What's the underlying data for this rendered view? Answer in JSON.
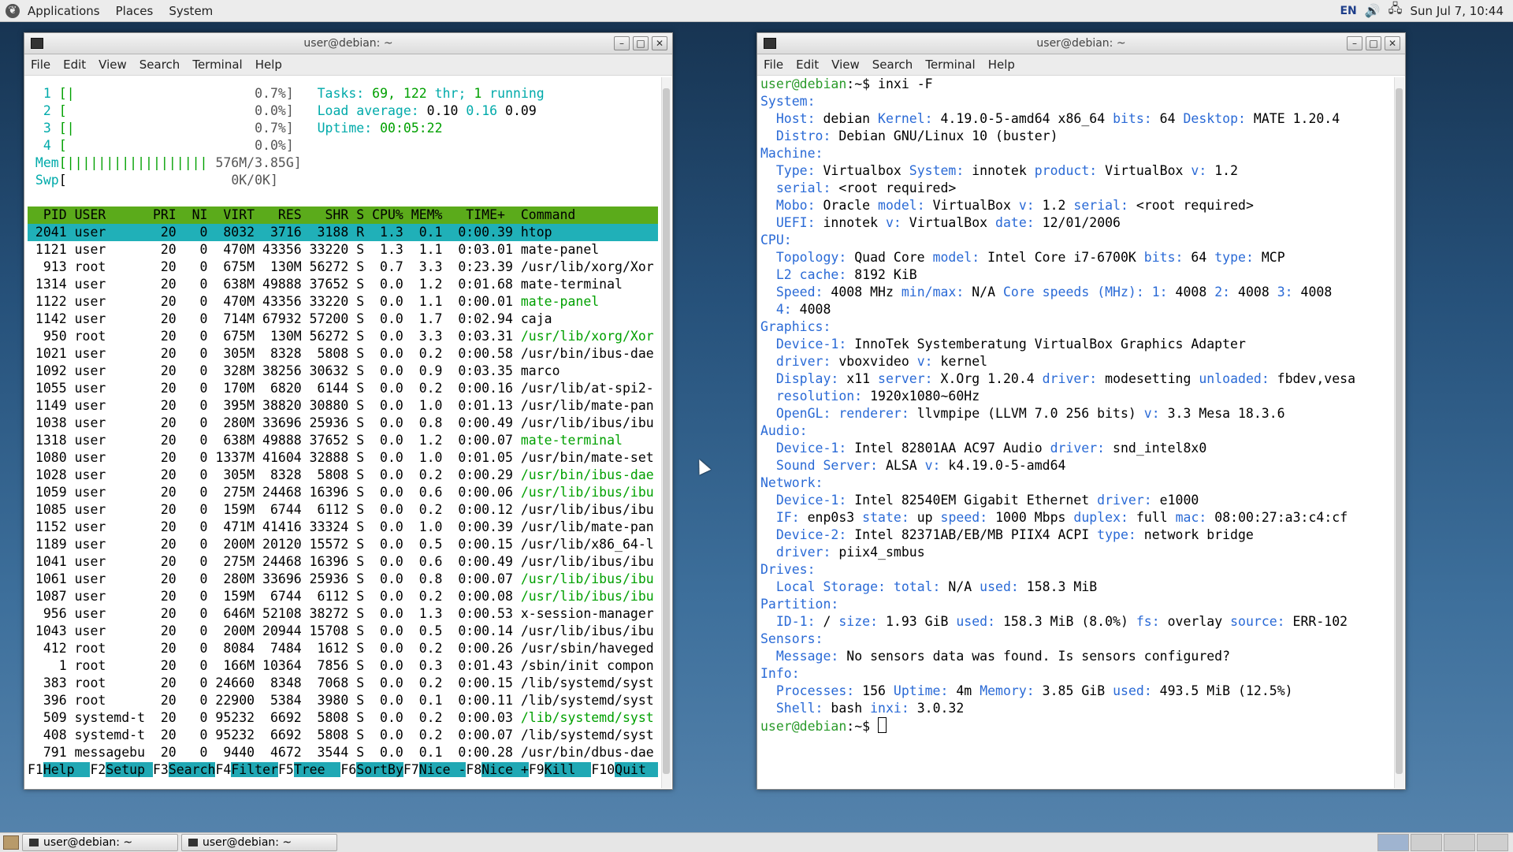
{
  "top_panel": {
    "menus": [
      "Applications",
      "Places",
      "System"
    ],
    "lang": "EN",
    "clock": "Sun Jul 7, 10:44"
  },
  "htop_window": {
    "title": "user@debian: ~",
    "menus": [
      "File",
      "Edit",
      "View",
      "Search",
      "Terminal",
      "Help"
    ],
    "cpus": [
      {
        "id": "1",
        "bar": "[|",
        "pct": "0.7%]"
      },
      {
        "id": "2",
        "bar": "[",
        "pct": "0.0%]"
      },
      {
        "id": "3",
        "bar": "[|",
        "pct": "0.7%]"
      },
      {
        "id": "4",
        "bar": "[",
        "pct": "0.0%]"
      }
    ],
    "mem": {
      "label": "Mem",
      "bar": "[||||||||||||||||||",
      "value": "576M/3.85G]"
    },
    "swp": {
      "label": "Swp",
      "bar": "[",
      "value": "0K/0K]"
    },
    "tasks": {
      "label": "Tasks:",
      "count": "69,",
      "thr": "122",
      "thr_label": "thr;",
      "running": "1",
      "running_label": "running"
    },
    "load": {
      "label": "Load average:",
      "v1": "0.10",
      "v2": "0.16",
      "v3": "0.09"
    },
    "uptime": {
      "label": "Uptime:",
      "value": "00:05:22"
    },
    "columns": "  PID USER      PRI  NI  VIRT   RES   SHR S CPU% MEM%   TIME+  Command",
    "selected_row": " 2041 user       20   0  8032  3716  3188 R  1.3  0.1  0:00.39 htop",
    "rows": [
      {
        "l": " 1121 user       20   0  470M 43356 33220 S  1.3  1.1  0:03.01 ",
        "cmd": "mate-panel",
        "t": "n"
      },
      {
        "l": "  913 root       20   0  675M  130M 56272 S  0.7  3.3  0:23.39 ",
        "cmd": "/usr/lib/xorg/Xor",
        "t": "n"
      },
      {
        "l": " 1314 user       20   0  638M 49888 37652 S  0.0  1.2  0:01.68 ",
        "cmd": "mate-terminal",
        "t": "n"
      },
      {
        "l": " 1122 user       20   0  470M 43356 33220 S  0.0  1.1  0:00.01 ",
        "cmd": "mate-panel",
        "t": "g"
      },
      {
        "l": " 1142 user       20   0  714M 67932 57200 S  0.0  1.7  0:02.94 ",
        "cmd": "caja",
        "t": "n"
      },
      {
        "l": "  950 root       20   0  675M  130M 56272 S  0.0  3.3  0:03.31 ",
        "cmd": "/usr/lib/xorg/Xor",
        "t": "g"
      },
      {
        "l": " 1021 user       20   0  305M  8328  5808 S  0.0  0.2  0:00.58 ",
        "cmd": "/usr/bin/ibus-dae",
        "t": "n"
      },
      {
        "l": " 1092 user       20   0  328M 38256 30632 S  0.0  0.9  0:03.35 ",
        "cmd": "marco",
        "t": "n"
      },
      {
        "l": " 1055 user       20   0  170M  6820  6144 S  0.0  0.2  0:00.16 ",
        "cmd": "/usr/lib/at-spi2-",
        "t": "n"
      },
      {
        "l": " 1149 user       20   0  395M 38820 30880 S  0.0  1.0  0:01.13 ",
        "cmd": "/usr/lib/mate-pan",
        "t": "n"
      },
      {
        "l": " 1038 user       20   0  280M 33696 25936 S  0.0  0.8  0:00.49 ",
        "cmd": "/usr/lib/ibus/ibu",
        "t": "n"
      },
      {
        "l": " 1318 user       20   0  638M 49888 37652 S  0.0  1.2  0:00.07 ",
        "cmd": "mate-terminal",
        "t": "g"
      },
      {
        "l": " 1080 user       20   0 1337M 41604 32888 S  0.0  1.0  0:01.05 ",
        "cmd": "/usr/bin/mate-set",
        "t": "n"
      },
      {
        "l": " 1028 user       20   0  305M  8328  5808 S  0.0  0.2  0:00.29 ",
        "cmd": "/usr/bin/ibus-dae",
        "t": "g"
      },
      {
        "l": " 1059 user       20   0  275M 24468 16396 S  0.0  0.6  0:00.06 ",
        "cmd": "/usr/lib/ibus/ibu",
        "t": "g"
      },
      {
        "l": " 1085 user       20   0  159M  6744  6112 S  0.0  0.2  0:00.12 ",
        "cmd": "/usr/lib/ibus/ibu",
        "t": "n"
      },
      {
        "l": " 1152 user       20   0  471M 41416 33324 S  0.0  1.0  0:00.39 ",
        "cmd": "/usr/lib/mate-pan",
        "t": "n"
      },
      {
        "l": " 1189 user       20   0  200M 20120 15572 S  0.0  0.5  0:00.15 ",
        "cmd": "/usr/lib/x86_64-l",
        "t": "n"
      },
      {
        "l": " 1041 user       20   0  275M 24468 16396 S  0.0  0.6  0:00.49 ",
        "cmd": "/usr/lib/ibus/ibu",
        "t": "n"
      },
      {
        "l": " 1061 user       20   0  280M 33696 25936 S  0.0  0.8  0:00.07 ",
        "cmd": "/usr/lib/ibus/ibu",
        "t": "g"
      },
      {
        "l": " 1087 user       20   0  159M  6744  6112 S  0.0  0.2  0:00.08 ",
        "cmd": "/usr/lib/ibus/ibu",
        "t": "g"
      },
      {
        "l": "  956 user       20   0  646M 52108 38272 S  0.0  1.3  0:00.53 ",
        "cmd": "x-session-manager",
        "t": "n"
      },
      {
        "l": " 1043 user       20   0  200M 20944 15708 S  0.0  0.5  0:00.14 ",
        "cmd": "/usr/lib/ibus/ibu",
        "t": "n"
      },
      {
        "l": "  412 root       20   0  8084  7484  1612 S  0.0  0.2  0:00.26 ",
        "cmd": "/usr/sbin/haveged",
        "t": "n"
      },
      {
        "l": "    1 root       20   0  166M 10364  7856 S  0.0  0.3  0:01.43 ",
        "cmd": "/sbin/init compon",
        "t": "n"
      },
      {
        "l": "  383 root       20   0 24660  8348  7068 S  0.0  0.2  0:00.15 ",
        "cmd": "/lib/systemd/syst",
        "t": "n"
      },
      {
        "l": "  396 root       20   0 22900  5384  3980 S  0.0  0.1  0:00.11 ",
        "cmd": "/lib/systemd/syst",
        "t": "n"
      },
      {
        "l": "  509 systemd-t  20   0 95232  6692  5808 S  0.0  0.2  0:00.03 ",
        "cmd": "/lib/systemd/syst",
        "t": "g"
      },
      {
        "l": "  408 systemd-t  20   0 95232  6692  5808 S  0.0  0.2  0:00.07 ",
        "cmd": "/lib/systemd/syst",
        "t": "n"
      },
      {
        "l": "  791 messagebu  20   0  9440  4672  3544 S  0.0  0.1  0:00.28 ",
        "cmd": "/usr/bin/dbus-dae",
        "t": "n"
      }
    ],
    "fkeys": [
      {
        "k": "F1",
        "l": "Help  "
      },
      {
        "k": "F2",
        "l": "Setup "
      },
      {
        "k": "F3",
        "l": "Search"
      },
      {
        "k": "F4",
        "l": "Filter"
      },
      {
        "k": "F5",
        "l": "Tree  "
      },
      {
        "k": "F6",
        "l": "SortBy"
      },
      {
        "k": "F7",
        "l": "Nice -"
      },
      {
        "k": "F8",
        "l": "Nice +"
      },
      {
        "k": "F9",
        "l": "Kill  "
      },
      {
        "k": "F10",
        "l": "Quit  "
      }
    ]
  },
  "inxi_window": {
    "title": "user@debian: ~",
    "menus": [
      "File",
      "Edit",
      "View",
      "Search",
      "Terminal",
      "Help"
    ],
    "prompt_user": "user@debian",
    "prompt_rest": ":~$ ",
    "command": "inxi -F",
    "lines": [
      [
        [
          "s",
          "System:"
        ]
      ],
      [
        [
          "p",
          "  "
        ],
        [
          "l",
          "Host:"
        ],
        [
          "v",
          " debian "
        ],
        [
          "l",
          "Kernel:"
        ],
        [
          "v",
          " 4.19.0-5-amd64 x86_64 "
        ],
        [
          "l",
          "bits:"
        ],
        [
          "v",
          " 64 "
        ],
        [
          "l",
          "Desktop:"
        ],
        [
          "v",
          " MATE 1.20.4"
        ]
      ],
      [
        [
          "p",
          "  "
        ],
        [
          "l",
          "Distro:"
        ],
        [
          "v",
          " Debian GNU/Linux 10 (buster)"
        ]
      ],
      [
        [
          "s",
          "Machine:"
        ]
      ],
      [
        [
          "p",
          "  "
        ],
        [
          "l",
          "Type:"
        ],
        [
          "v",
          " Virtualbox "
        ],
        [
          "l",
          "System:"
        ],
        [
          "v",
          " innotek "
        ],
        [
          "l",
          "product:"
        ],
        [
          "v",
          " VirtualBox "
        ],
        [
          "l",
          "v:"
        ],
        [
          "v",
          " 1.2"
        ]
      ],
      [
        [
          "p",
          "  "
        ],
        [
          "l",
          "serial:"
        ],
        [
          "v",
          " <root required>"
        ]
      ],
      [
        [
          "p",
          "  "
        ],
        [
          "l",
          "Mobo:"
        ],
        [
          "v",
          " Oracle "
        ],
        [
          "l",
          "model:"
        ],
        [
          "v",
          " VirtualBox "
        ],
        [
          "l",
          "v:"
        ],
        [
          "v",
          " 1.2 "
        ],
        [
          "l",
          "serial:"
        ],
        [
          "v",
          " <root required>"
        ]
      ],
      [
        [
          "p",
          "  "
        ],
        [
          "l",
          "UEFI:"
        ],
        [
          "v",
          " innotek "
        ],
        [
          "l",
          "v:"
        ],
        [
          "v",
          " VirtualBox "
        ],
        [
          "l",
          "date:"
        ],
        [
          "v",
          " 12/01/2006"
        ]
      ],
      [
        [
          "s",
          "CPU:"
        ]
      ],
      [
        [
          "p",
          "  "
        ],
        [
          "l",
          "Topology:"
        ],
        [
          "v",
          " Quad Core "
        ],
        [
          "l",
          "model:"
        ],
        [
          "v",
          " Intel Core i7-6700K "
        ],
        [
          "l",
          "bits:"
        ],
        [
          "v",
          " 64 "
        ],
        [
          "l",
          "type:"
        ],
        [
          "v",
          " MCP"
        ]
      ],
      [
        [
          "p",
          "  "
        ],
        [
          "l",
          "L2 cache:"
        ],
        [
          "v",
          " 8192 KiB"
        ]
      ],
      [
        [
          "p",
          "  "
        ],
        [
          "l",
          "Speed:"
        ],
        [
          "v",
          " 4008 MHz "
        ],
        [
          "l",
          "min/max:"
        ],
        [
          "v",
          " N/A "
        ],
        [
          "l",
          "Core speeds (MHz):"
        ],
        [
          "v",
          " "
        ],
        [
          "l",
          "1:"
        ],
        [
          "v",
          " 4008 "
        ],
        [
          "l",
          "2:"
        ],
        [
          "v",
          " 4008 "
        ],
        [
          "l",
          "3:"
        ],
        [
          "v",
          " 4008"
        ]
      ],
      [
        [
          "p",
          "  "
        ],
        [
          "l",
          "4:"
        ],
        [
          "v",
          " 4008"
        ]
      ],
      [
        [
          "s",
          "Graphics:"
        ]
      ],
      [
        [
          "p",
          "  "
        ],
        [
          "l",
          "Device-1:"
        ],
        [
          "v",
          " InnoTek Systemberatung VirtualBox Graphics Adapter"
        ]
      ],
      [
        [
          "p",
          "  "
        ],
        [
          "l",
          "driver:"
        ],
        [
          "v",
          " vboxvideo "
        ],
        [
          "l",
          "v:"
        ],
        [
          "v",
          " kernel"
        ]
      ],
      [
        [
          "p",
          "  "
        ],
        [
          "l",
          "Display:"
        ],
        [
          "v",
          " x11 "
        ],
        [
          "l",
          "server:"
        ],
        [
          "v",
          " X.Org 1.20.4 "
        ],
        [
          "l",
          "driver:"
        ],
        [
          "v",
          " modesetting "
        ],
        [
          "l",
          "unloaded:"
        ],
        [
          "v",
          " fbdev,vesa"
        ]
      ],
      [
        [
          "p",
          "  "
        ],
        [
          "l",
          "resolution:"
        ],
        [
          "v",
          " 1920x1080~60Hz"
        ]
      ],
      [
        [
          "p",
          "  "
        ],
        [
          "l",
          "OpenGL:"
        ],
        [
          "v",
          " "
        ],
        [
          "l",
          "renderer:"
        ],
        [
          "v",
          " llvmpipe (LLVM 7.0 256 bits) "
        ],
        [
          "l",
          "v:"
        ],
        [
          "v",
          " 3.3 Mesa 18.3.6"
        ]
      ],
      [
        [
          "s",
          "Audio:"
        ]
      ],
      [
        [
          "p",
          "  "
        ],
        [
          "l",
          "Device-1:"
        ],
        [
          "v",
          " Intel 82801AA AC97 Audio "
        ],
        [
          "l",
          "driver:"
        ],
        [
          "v",
          " snd_intel8x0"
        ]
      ],
      [
        [
          "p",
          "  "
        ],
        [
          "l",
          "Sound Server:"
        ],
        [
          "v",
          " ALSA "
        ],
        [
          "l",
          "v:"
        ],
        [
          "v",
          " k4.19.0-5-amd64"
        ]
      ],
      [
        [
          "s",
          "Network:"
        ]
      ],
      [
        [
          "p",
          "  "
        ],
        [
          "l",
          "Device-1:"
        ],
        [
          "v",
          " Intel 82540EM Gigabit Ethernet "
        ],
        [
          "l",
          "driver:"
        ],
        [
          "v",
          " e1000"
        ]
      ],
      [
        [
          "p",
          "  "
        ],
        [
          "l",
          "IF:"
        ],
        [
          "v",
          " enp0s3 "
        ],
        [
          "l",
          "state:"
        ],
        [
          "v",
          " up "
        ],
        [
          "l",
          "speed:"
        ],
        [
          "v",
          " 1000 Mbps "
        ],
        [
          "l",
          "duplex:"
        ],
        [
          "v",
          " full "
        ],
        [
          "l",
          "mac:"
        ],
        [
          "v",
          " 08:00:27:a3:c4:cf"
        ]
      ],
      [
        [
          "p",
          "  "
        ],
        [
          "l",
          "Device-2:"
        ],
        [
          "v",
          " Intel 82371AB/EB/MB PIIX4 ACPI "
        ],
        [
          "l",
          "type:"
        ],
        [
          "v",
          " network bridge"
        ]
      ],
      [
        [
          "p",
          "  "
        ],
        [
          "l",
          "driver:"
        ],
        [
          "v",
          " piix4_smbus"
        ]
      ],
      [
        [
          "s",
          "Drives:"
        ]
      ],
      [
        [
          "p",
          "  "
        ],
        [
          "l",
          "Local Storage:"
        ],
        [
          "v",
          " "
        ],
        [
          "l",
          "total:"
        ],
        [
          "v",
          " N/A "
        ],
        [
          "l",
          "used:"
        ],
        [
          "v",
          " 158.3 MiB"
        ]
      ],
      [
        [
          "s",
          "Partition:"
        ]
      ],
      [
        [
          "p",
          "  "
        ],
        [
          "l",
          "ID-1:"
        ],
        [
          "v",
          " / "
        ],
        [
          "l",
          "size:"
        ],
        [
          "v",
          " 1.93 GiB "
        ],
        [
          "l",
          "used:"
        ],
        [
          "v",
          " 158.3 MiB (8.0%) "
        ],
        [
          "l",
          "fs:"
        ],
        [
          "v",
          " overlay "
        ],
        [
          "l",
          "source:"
        ],
        [
          "v",
          " ERR-102"
        ]
      ],
      [
        [
          "s",
          "Sensors:"
        ]
      ],
      [
        [
          "p",
          "  "
        ],
        [
          "l",
          "Message:"
        ],
        [
          "v",
          " No sensors data was found. Is sensors configured?"
        ]
      ],
      [
        [
          "s",
          "Info:"
        ]
      ],
      [
        [
          "p",
          "  "
        ],
        [
          "l",
          "Processes:"
        ],
        [
          "v",
          " 156 "
        ],
        [
          "l",
          "Uptime:"
        ],
        [
          "v",
          " 4m "
        ],
        [
          "l",
          "Memory:"
        ],
        [
          "v",
          " 3.85 GiB "
        ],
        [
          "l",
          "used:"
        ],
        [
          "v",
          " 493.5 MiB (12.5%)"
        ]
      ],
      [
        [
          "p",
          "  "
        ],
        [
          "l",
          "Shell:"
        ],
        [
          "v",
          " bash "
        ],
        [
          "l",
          "inxi:"
        ],
        [
          "v",
          " 3.0.32"
        ]
      ]
    ]
  },
  "taskbar": {
    "tasks": [
      "user@debian: ~",
      "user@debian: ~"
    ]
  },
  "colors": {
    "htop_header": "#5bab1b",
    "htop_selected": "#20b0b8",
    "inxi_label": "#2a6ad6",
    "prompt_user": "#2a9a2a"
  }
}
